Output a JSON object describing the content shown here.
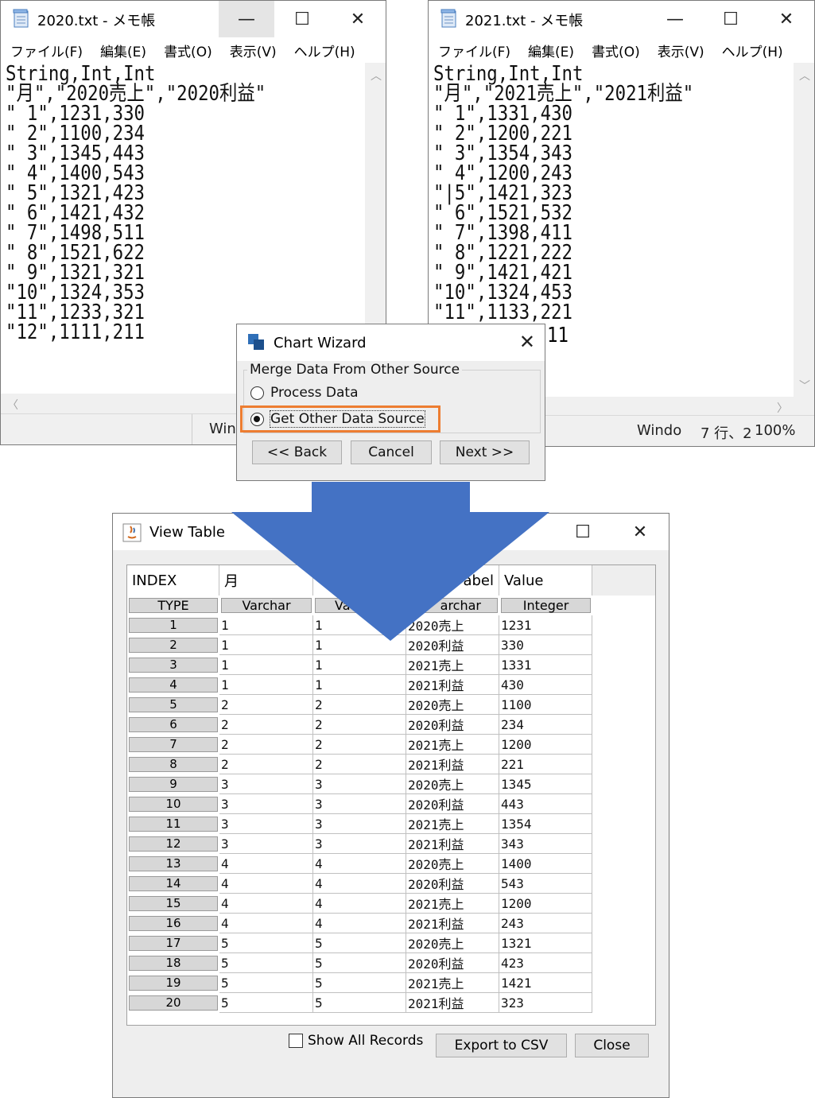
{
  "notepad_left": {
    "title": "2020.txt - メモ帳",
    "menu": [
      "ファイル(F)",
      "編集(E)",
      "書式(O)",
      "表示(V)",
      "ヘルプ(H)"
    ],
    "content": "String,Int,Int\n\"月\",\"2020売上\",\"2020利益\"\n\" 1\",1231,330\n\" 2\",1100,234\n\" 3\",1345,443\n\" 4\",1400,543\n\" 5\",1321,423\n\" 6\",1421,432\n\" 7\",1498,511\n\" 8\",1521,622\n\" 9\",1321,321\n\"10\",1324,353\n\"11\",1233,321\n\"12\",1111,211",
    "status": "Win"
  },
  "notepad_right": {
    "title": "2021.txt - メモ帳",
    "menu": [
      "ファイル(F)",
      "編集(E)",
      "書式(O)",
      "表示(V)",
      "ヘルプ(H)"
    ],
    "content": "String,Int,Int\n\"月\",\"2021売上\",\"2021利益\"\n\" 1\",1331,430\n\" 2\",1200,221\n\" 3\",1354,343\n\" 4\",1200,243\n\"|5\",1421,323\n\" 6\",1521,532\n\" 7\",1398,411\n\" 8\",1221,222\n\" 9\",1421,421\n\"10\",1324,453\n\"11\",1133,221",
    "content_tail": "11",
    "status_encoding": "Windo",
    "status_position": "7 行、2",
    "status_zoom": "100%"
  },
  "wizard": {
    "title": "Chart Wizard",
    "group_label": "Merge Data From Other Source",
    "option_process": "Process Data",
    "option_get": "Get Other Data Source",
    "back": "<< Back",
    "cancel": "Cancel",
    "next": "Next >>"
  },
  "viewtable": {
    "title": "View Table",
    "columns": [
      {
        "name": "INDEX",
        "type": "TYPE"
      },
      {
        "name": "月",
        "type": "Varchar"
      },
      {
        "name": "",
        "type": "Va"
      },
      {
        "name": "abel",
        "type": "archar"
      },
      {
        "name": "Value",
        "type": "Integer"
      }
    ],
    "rows": [
      [
        "1",
        "1",
        "1",
        "2020売上",
        "1231"
      ],
      [
        "2",
        "1",
        "1",
        "2020利益",
        "330"
      ],
      [
        "3",
        "1",
        "1",
        "2021売上",
        "1331"
      ],
      [
        "4",
        "1",
        "1",
        "2021利益",
        "430"
      ],
      [
        "5",
        "2",
        "2",
        "2020売上",
        "1100"
      ],
      [
        "6",
        "2",
        "2",
        "2020利益",
        "234"
      ],
      [
        "7",
        "2",
        "2",
        "2021売上",
        "1200"
      ],
      [
        "8",
        "2",
        "2",
        "2021利益",
        "221"
      ],
      [
        "9",
        "3",
        "3",
        "2020売上",
        "1345"
      ],
      [
        "10",
        "3",
        "3",
        "2020利益",
        "443"
      ],
      [
        "11",
        "3",
        "3",
        "2021売上",
        "1354"
      ],
      [
        "12",
        "3",
        "3",
        "2021利益",
        "343"
      ],
      [
        "13",
        "4",
        "4",
        "2020売上",
        "1400"
      ],
      [
        "14",
        "4",
        "4",
        "2020利益",
        "543"
      ],
      [
        "15",
        "4",
        "4",
        "2021売上",
        "1200"
      ],
      [
        "16",
        "4",
        "4",
        "2021利益",
        "243"
      ],
      [
        "17",
        "5",
        "5",
        "2020売上",
        "1321"
      ],
      [
        "18",
        "5",
        "5",
        "2020利益",
        "423"
      ],
      [
        "19",
        "5",
        "5",
        "2021売上",
        "1421"
      ],
      [
        "20",
        "5",
        "5",
        "2021利益",
        "323"
      ]
    ],
    "show_all": "Show All Records",
    "export": "Export to CSV",
    "close": "Close"
  },
  "colors": {
    "highlight": "#ed7d31",
    "arrow": "#4472c4"
  }
}
